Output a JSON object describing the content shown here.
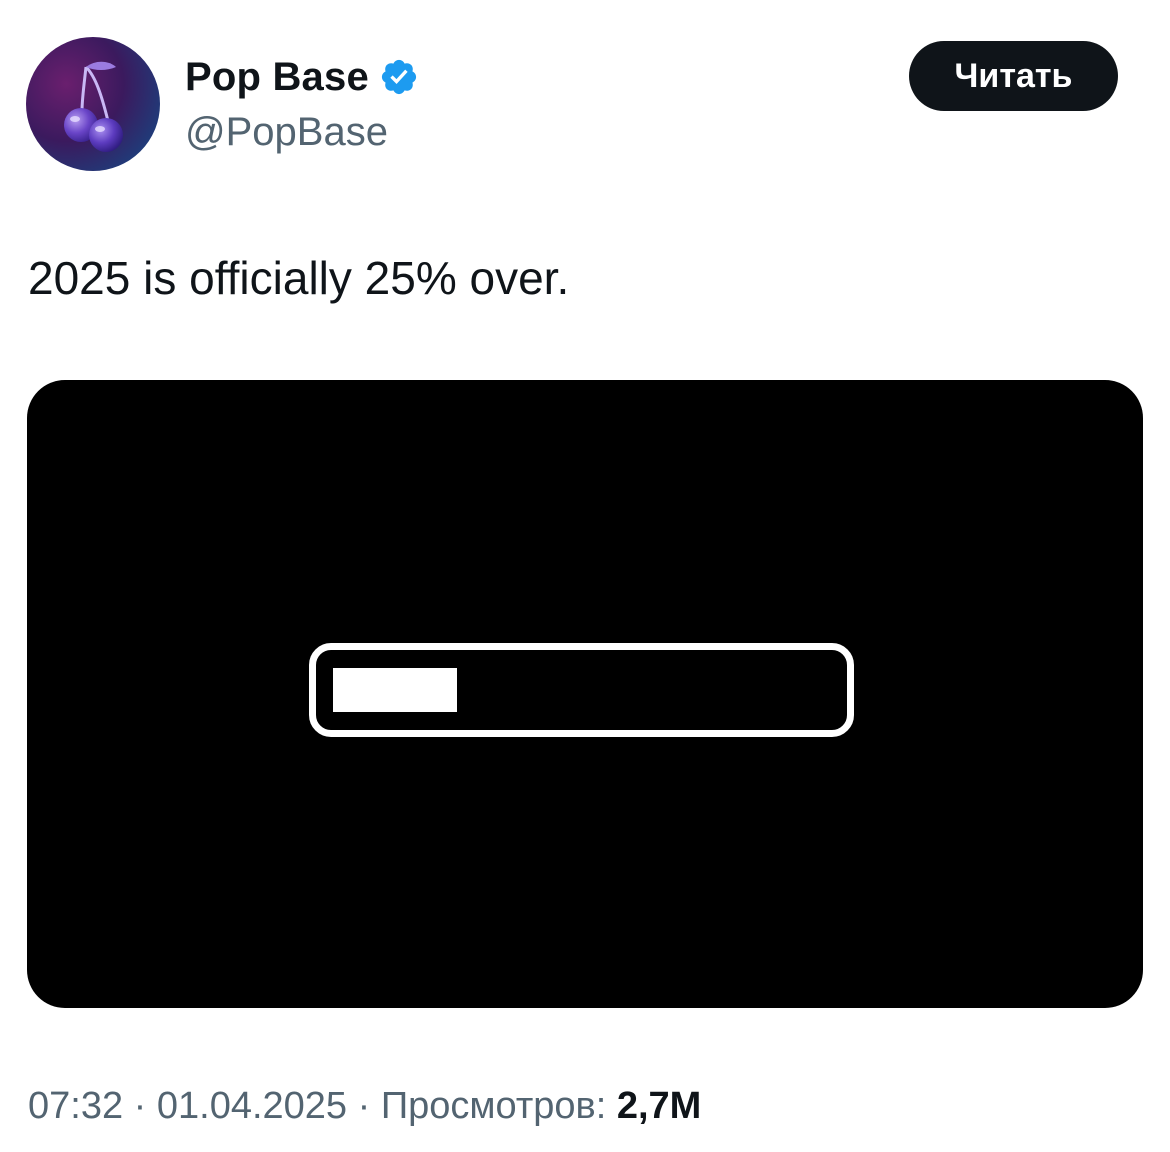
{
  "tweet": {
    "author": {
      "display_name": "Pop Base",
      "handle": "@PopBase",
      "verified": true,
      "avatar_icon": "cherry-icon"
    },
    "follow_button_label": "Читать",
    "text": "2025 is officially 25% over.",
    "media": {
      "type": "image",
      "description_icon": "progress-bar-icon",
      "progress_fraction": 0.25,
      "background_color": "#000000",
      "foreground_color": "#ffffff"
    },
    "meta": {
      "time": "07:32",
      "separator": " · ",
      "date": "01.04.2025",
      "views_label": "Просмотров:",
      "views_count": "2,7M"
    }
  },
  "colors": {
    "text_primary": "#0f1419",
    "text_secondary": "#536471",
    "verified_badge": "#1d9bf0",
    "button_bg": "#0f1419",
    "button_text": "#ffffff"
  }
}
